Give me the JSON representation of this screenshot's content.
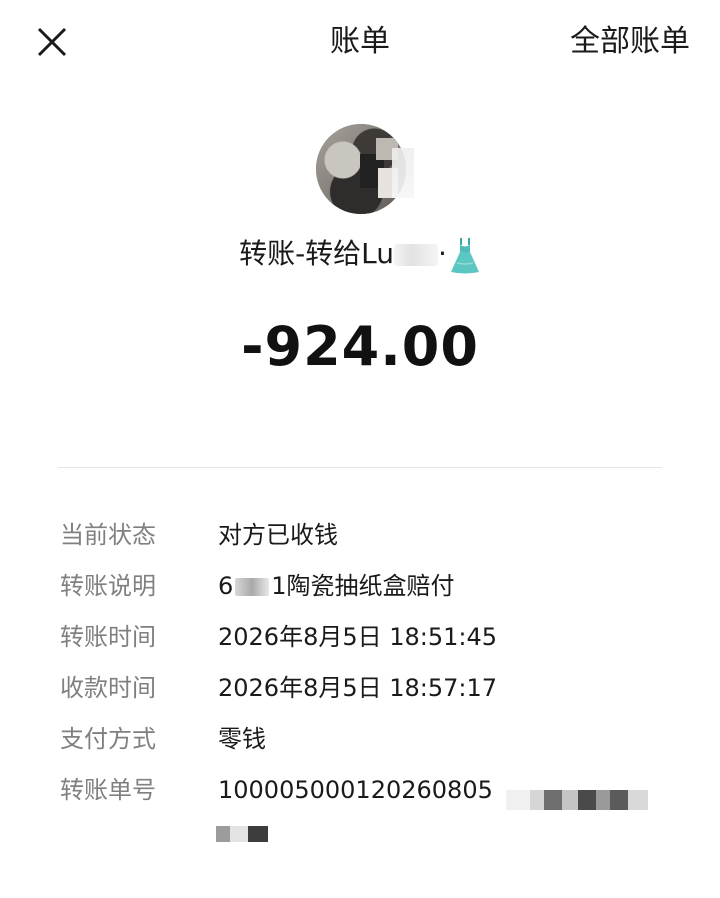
{
  "header": {
    "close_icon": "close-icon",
    "title": "账单",
    "all_bills_label": "全部账单"
  },
  "transfer": {
    "avatar_icon": "user-avatar",
    "title_prefix": "转账-转给Lu",
    "title_suffix": "·",
    "emoji_icon": "dress-emoji-icon",
    "amount": "-924.00"
  },
  "details": [
    {
      "label": "当前状态",
      "value": "对方已收钱"
    },
    {
      "label": "转账说明",
      "value_prefix": "6",
      "value_suffix": "1陶瓷抽纸盒赔付"
    },
    {
      "label": "转账时间",
      "value": "2026年8月5日 18:51:45"
    },
    {
      "label": "收款时间",
      "value": "2026年8月5日 18:57:17"
    },
    {
      "label": "支付方式",
      "value": "零钱"
    },
    {
      "label": "转账单号",
      "value": "100005000120260805"
    }
  ],
  "colors": {
    "label_gray": "#808080",
    "text_dark": "#1a1a1a",
    "divider": "#e6e6e6",
    "dress_teal": "#5cc6c2"
  }
}
